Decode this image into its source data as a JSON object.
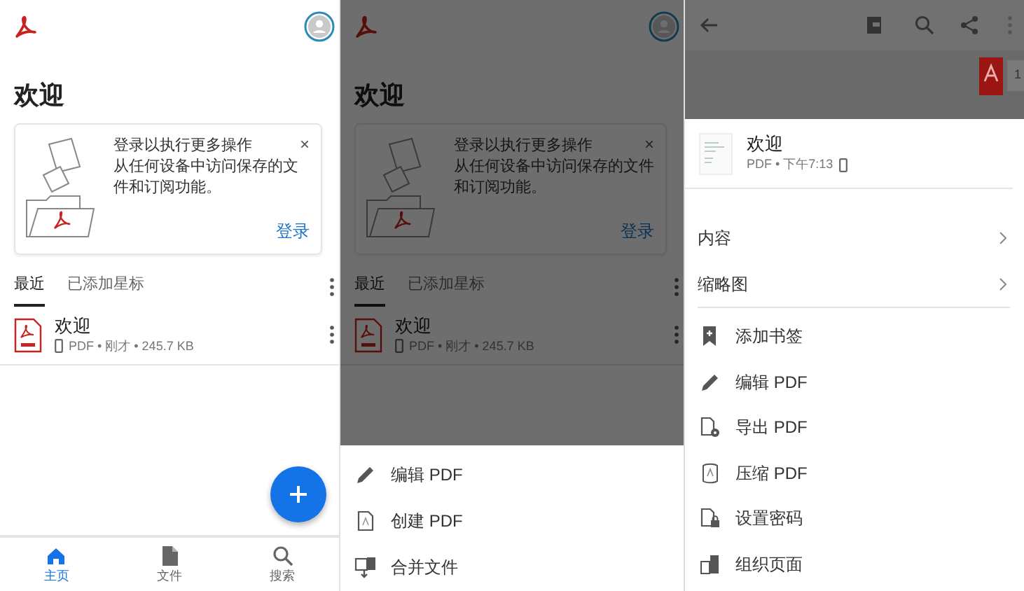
{
  "home": {
    "title": "欢迎",
    "signin_card": {
      "heading": "登录以执行更多操作",
      "body": "从任何设备中访问保存的文件和订阅功能。",
      "close": "×",
      "action": "登录"
    },
    "tabs": [
      {
        "label": "最近",
        "selected": true
      },
      {
        "label": "已添加星标",
        "selected": false
      }
    ],
    "files": [
      {
        "name": "欢迎",
        "meta": "PDF • 刚才 • 245.7 KB"
      }
    ],
    "nav": [
      {
        "label": "主页",
        "selected": true
      },
      {
        "label": "文件",
        "selected": false
      },
      {
        "label": "搜索",
        "selected": false
      }
    ]
  },
  "home_with_menu": {
    "title": "欢迎",
    "signin_card": {
      "heading": "登录以执行更多操作",
      "body": "从任何设备中访问保存的文件和订阅功能。",
      "close": "×",
      "action": "登录"
    },
    "tabs": [
      {
        "label": "最近",
        "selected": true
      },
      {
        "label": "已添加星标",
        "selected": false
      }
    ],
    "files": [
      {
        "name": "欢迎",
        "meta": "PDF • 刚才 • 245.7 KB"
      }
    ],
    "action_sheet": [
      "编辑 PDF",
      "创建 PDF",
      "合并文件"
    ]
  },
  "reader": {
    "page_number": "1",
    "file": {
      "name": "欢迎",
      "meta": "PDF • 下午7:13"
    },
    "sections": [
      "内容",
      "缩略图"
    ],
    "actions": [
      "添加书签",
      "编辑 PDF",
      "导出 PDF",
      "压缩 PDF",
      "设置密码",
      "组织页面"
    ]
  }
}
